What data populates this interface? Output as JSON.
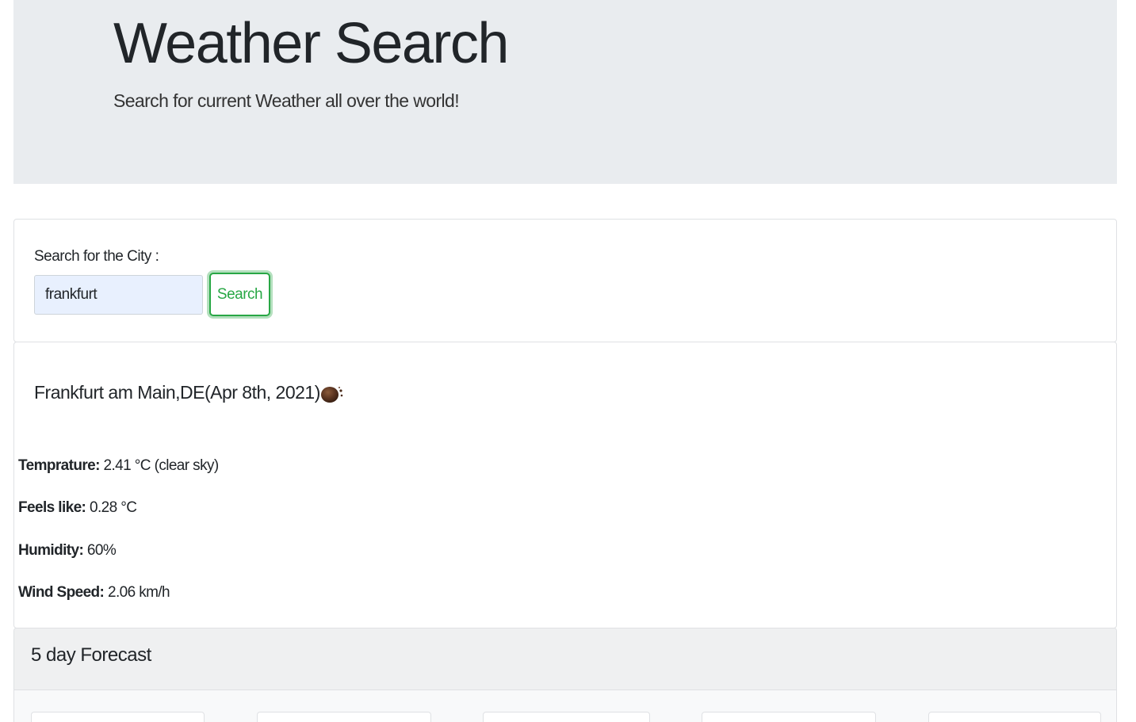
{
  "jumbotron": {
    "title": "Weather Search",
    "subtitle": "Search for current Weather all over the world!"
  },
  "search": {
    "label": "Search for the City :",
    "value": "frankfurt",
    "button_label": "Search",
    "button_color": "#28a745"
  },
  "current": {
    "city_title": "Frankfurt am Main,DE(Apr 8th, 2021)",
    "icon": "clear-sky-icon",
    "temperature_label": "Temprature:",
    "temperature_value": " 2.41 °C (clear sky)",
    "feels_like_label": "Feels like:",
    "feels_like_value": " 0.28 °C",
    "humidity_label": "Humidity:",
    "humidity_value": " 60%",
    "wind_label": "Wind Speed:",
    "wind_value": " 2.06 km/h"
  },
  "forecast": {
    "title": "5 day Forecast",
    "card_count": 5
  }
}
